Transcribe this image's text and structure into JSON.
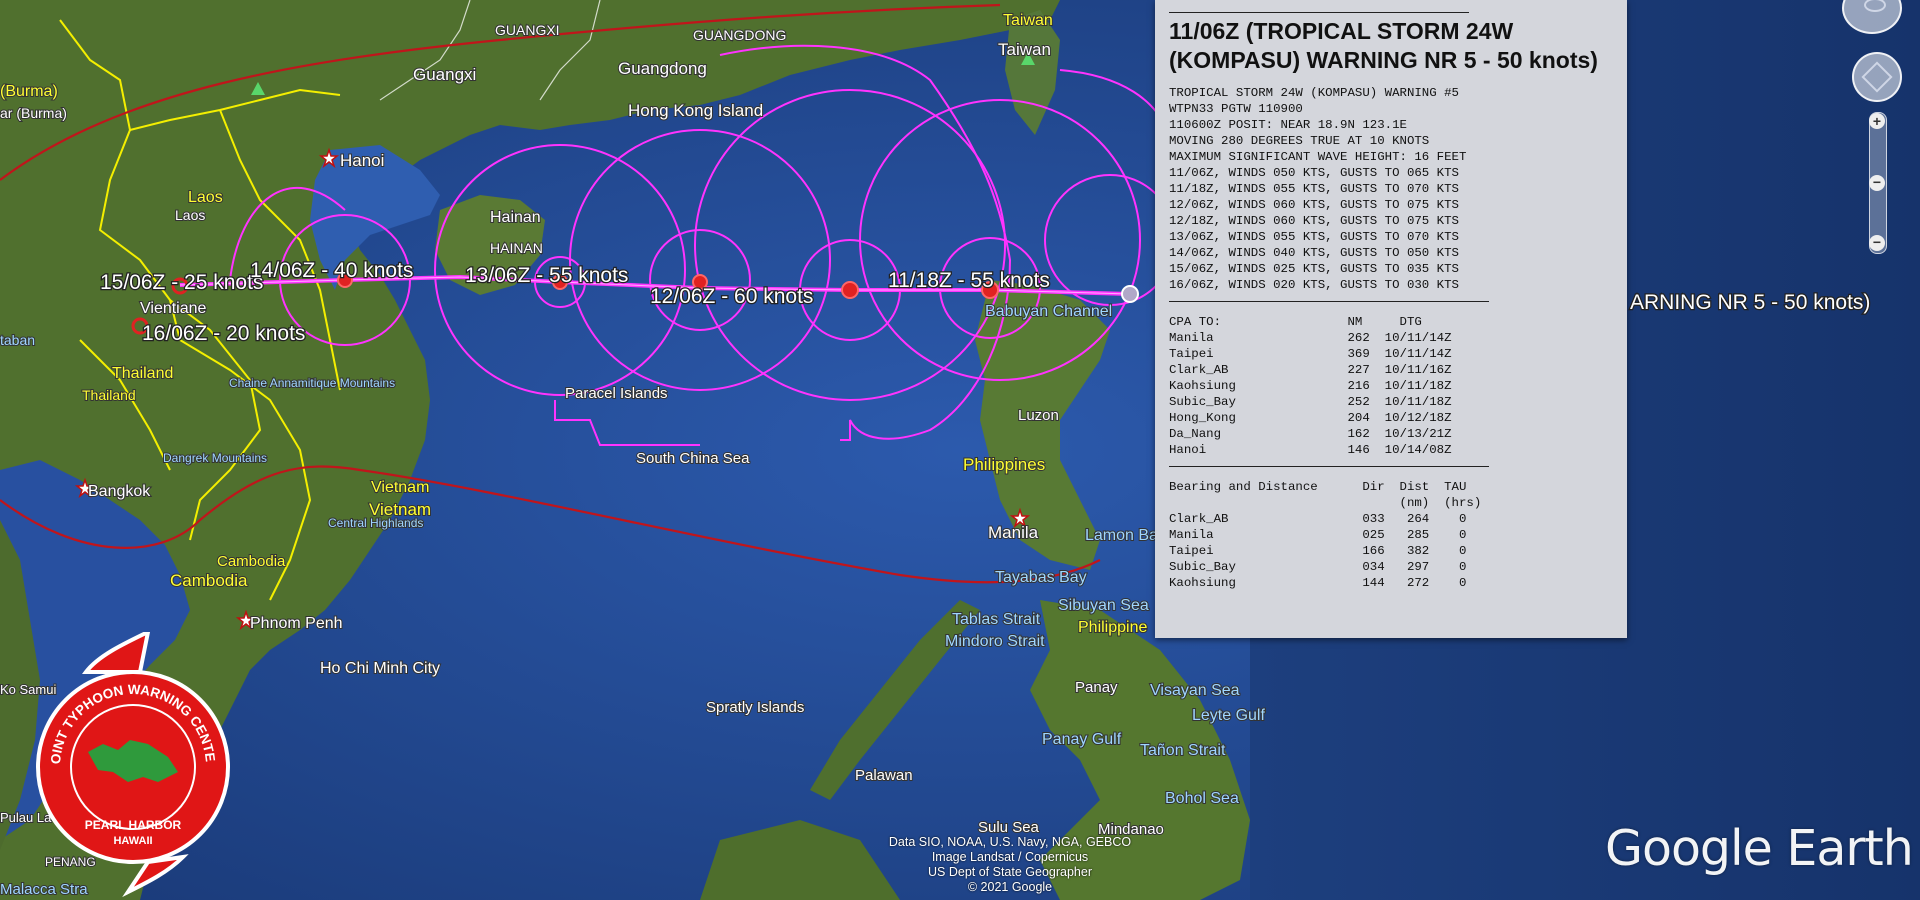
{
  "map": {
    "places": {
      "guangxi": "GUANGXI",
      "guangdong_upper": "GUANGDONG",
      "guangxi_road": "Guangxi",
      "guangdong": "Guangdong",
      "hongkong": "Hong Kong Island",
      "taiwan1": "Taiwan",
      "taiwan2": "Taiwan",
      "burma1": "(Burma)",
      "burma2": "ar (Burma)",
      "hanoi": "Hanoi",
      "laos1": "Laos",
      "laos2": "Laos",
      "hainan1": "Hainan",
      "hainan2": "HAINAN",
      "vientiane": "Vientiane",
      "thailand1": "Thailand",
      "thailand2": "Thailand",
      "taban": "taban",
      "chaine": "Chaine Annamitique Mountains",
      "paracel": "Paracel Islands",
      "dangrek": "Dangrek Mountains",
      "scs": "South China Sea",
      "bangkok": "Bangkok",
      "vietnam1": "Vietnam",
      "vietnam2": "Vietnam",
      "central_highlands": "Central Highlands",
      "cambodia1": "Cambodia",
      "cambodia2": "Cambodia",
      "phnom_penh": "Phnom Penh",
      "hcmc": "Ho Chi Minh City",
      "babuyan": "Babuyan Channel",
      "luzon": "Luzon",
      "philippines": "Philippines",
      "manila": "Manila",
      "lamon": "Lamon Ba",
      "tayabas": "Tayabas Bay",
      "sibuyan": "Sibuyan Sea",
      "tablas": "Tablas Strait",
      "mindoro": "Mindoro Strait",
      "philippine2": "Philippine",
      "visayan": "Visayan Sea",
      "leyte": "Leyte Gulf",
      "panay": "Panay",
      "panay_gulf": "Panay Gulf",
      "tanon": "Tañon Strait",
      "bohol": "Bohol Sea",
      "spratly": "Spratly Islands",
      "palawan": "Palawan",
      "sulu": "Sulu Sea",
      "mindanao": "Mindanao",
      "ko_samui": "Ko Samui",
      "pulau": "Pulau La",
      "penang": "PENANG",
      "malacca": "Malacca Stra"
    },
    "track_labels": {
      "t1518": "15/06Z - 25 knots",
      "t1418": "14/06Z - 40 knots",
      "t1306": "13/06Z - 55 knots",
      "t1206": "12/06Z - 60 knots",
      "t1118": "11/18Z - 55 knots",
      "t1606": "16/06Z - 20 knots"
    },
    "cut_label": "ARNING NR 5    - 50 knots)",
    "colors": {
      "track": "#ff33ff",
      "danger_swath": "#c0151b",
      "border": "#f4f000",
      "water": "#2a57a8",
      "land": "#4d6b2d"
    }
  },
  "popup": {
    "title": "11/06Z (TROPICAL STORM 24W (KOMPASU) WARNING NR 5 - 50 knots)",
    "warning_text": "TROPICAL STORM 24W (KOMPASU) WARNING #5\nWTPN33 PGTW 110900\n110600Z POSIT: NEAR 18.9N 123.1E\nMOVING 280 DEGREES TRUE AT 10 KNOTS\nMAXIMUM SIGNIFICANT WAVE HEIGHT: 16 FEET\n11/06Z, WINDS 050 KTS, GUSTS TO 065 KTS\n11/18Z, WINDS 055 KTS, GUSTS TO 070 KTS\n12/06Z, WINDS 060 KTS, GUSTS TO 075 KTS\n12/18Z, WINDS 060 KTS, GUSTS TO 075 KTS\n13/06Z, WINDS 055 KTS, GUSTS TO 070 KTS\n14/06Z, WINDS 040 KTS, GUSTS TO 050 KTS\n15/06Z, WINDS 025 KTS, GUSTS TO 035 KTS\n16/06Z, WINDS 020 KTS, GUSTS TO 030 KTS",
    "cpa_text": "CPA TO:                 NM     DTG\nManila                  262  10/11/14Z\nTaipei                  369  10/11/14Z\nClark_AB                227  10/11/16Z\nKaohsiung               216  10/11/18Z\nSubic_Bay               252  10/11/18Z\nHong_Kong               204  10/12/18Z\nDa_Nang                 162  10/13/21Z\nHanoi                   146  10/14/08Z",
    "bearing_text": "Bearing and Distance      Dir  Dist  TAU\n                               (nm)  (hrs)\nClark_AB                  033   264    0\nManila                    025   285    0\nTaipei                    166   382    0\nSubic_Bay                 034   297    0\nKaohsiung                 144   272    0"
  },
  "logo": {
    "jtwc_top": "JOINT TYPHOON WARNING CENTER",
    "jtwc_bottom1": "PEARL HARBOR",
    "jtwc_bottom2": "HAWAII"
  },
  "credits": {
    "line1": "Data SIO, NOAA, U.S. Navy, NGA, GEBCO",
    "line2": "Image Landsat / Copernicus",
    "line3": "US Dept of State Geographer",
    "line4": "© 2021 Google"
  },
  "google_earth": "Google Earth"
}
